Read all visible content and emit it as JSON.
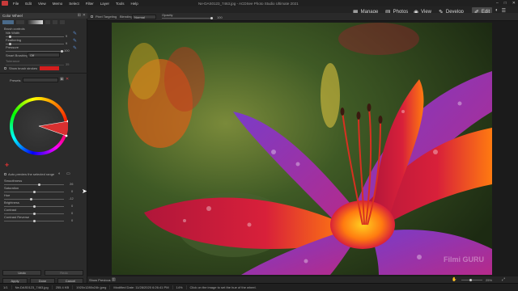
{
  "menubar": {
    "items": [
      "File",
      "Edit",
      "View",
      "Memo",
      "Select",
      "Filter",
      "Layer",
      "Tools",
      "Help"
    ],
    "title": "Ne-DAS0123_7463.jpg - ACDSee Photo Studio Ultimate 2021"
  },
  "modes": [
    {
      "label": "Manage",
      "icon": "manage-icon"
    },
    {
      "label": "Photos",
      "icon": "photos-icon"
    },
    {
      "label": "View",
      "icon": "view-icon"
    },
    {
      "label": "Develop",
      "icon": "develop-icon"
    },
    {
      "label": "Edit",
      "icon": "edit-icon"
    }
  ],
  "panel": {
    "title": "Color Wheel",
    "brush_controls": "Brush controls",
    "nib_width": {
      "label": "Nib Width",
      "value": "9"
    },
    "feathering": {
      "label": "Feathering",
      "value": "9"
    },
    "pressure": {
      "label": "Pressure",
      "value": "100"
    },
    "smart_brushing": {
      "label": "Smart Brushing",
      "option": "Off"
    },
    "tolerance": {
      "label": "Tolerance",
      "value": "35"
    },
    "show_brush_strokes": "Show brush strokes",
    "presets": "Presets",
    "auto_preview": "Auto preview the selected range",
    "smoothness": {
      "label": "Smoothness",
      "value": "26"
    },
    "saturation": {
      "label": "Saturation",
      "value": "0"
    },
    "hue": {
      "label": "Hue",
      "value": "-12"
    },
    "brightness": {
      "label": "Brightness",
      "value": "0"
    },
    "contrast": {
      "label": "Contrast",
      "value": "0"
    },
    "contrast_reverse": {
      "label": "Contrast Reverse",
      "value": "0"
    },
    "undo": "Undo",
    "redo": "Redo",
    "apply": "Apply",
    "done": "Done",
    "cancel": "Cancel"
  },
  "editstrip": {
    "pixel_targeting": "Pixel Targeting",
    "blending": "Blending:",
    "blending_value": "Normal",
    "opacity": "Opacity",
    "opacity_value": "100"
  },
  "bottomtools": {
    "show_previous": "Show Previous",
    "zoom": "25%"
  },
  "status": {
    "index": "1/1",
    "filename": "Ne-DAS0123_7463.jpg",
    "filesize": "255.4 KB",
    "dimensions": "1920x1280x24b jpeg",
    "modified": "Modified Date: 11/28/2020 6:26:41 PM",
    "zoom": "14%",
    "hint": "Click on the image to set the hue of the wheel."
  },
  "watermark": "Filmi GURU",
  "colors": {
    "accent": "#d23636",
    "panel": "#2b2b2b",
    "bg": "#1e1e1e"
  }
}
